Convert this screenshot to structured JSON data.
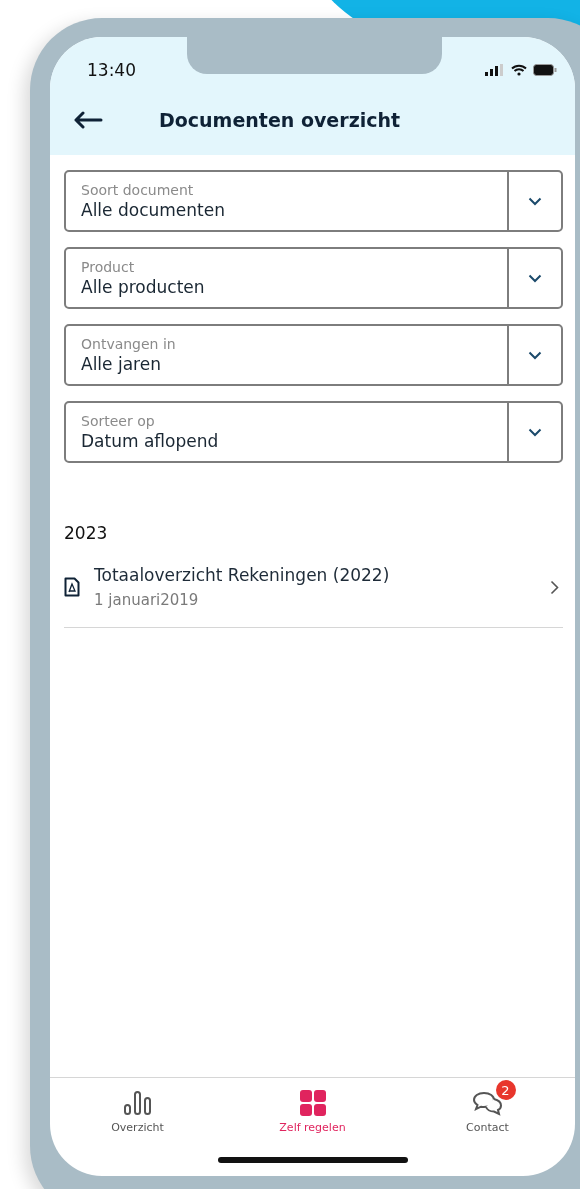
{
  "status_bar": {
    "time": "13:40"
  },
  "header": {
    "title": "Documenten overzicht"
  },
  "filters": [
    {
      "label": "Soort document",
      "value": "Alle documenten"
    },
    {
      "label": "Product",
      "value": "Alle producten"
    },
    {
      "label": "Ontvangen in",
      "value": "Alle jaren"
    },
    {
      "label": "Sorteer op",
      "value": "Datum aflopend"
    }
  ],
  "sections": [
    {
      "year": "2023",
      "documents": [
        {
          "title": "Totaaloverzicht Rekeningen (2022)",
          "date": "1 januari2019"
        }
      ]
    }
  ],
  "tab_bar": [
    {
      "kind": "chart",
      "label": "Overzicht",
      "selected": false
    },
    {
      "kind": "grid",
      "label": "Zelf regelen",
      "selected": true
    },
    {
      "kind": "chat",
      "label": "Contact",
      "selected": false,
      "badge": "2"
    }
  ]
}
